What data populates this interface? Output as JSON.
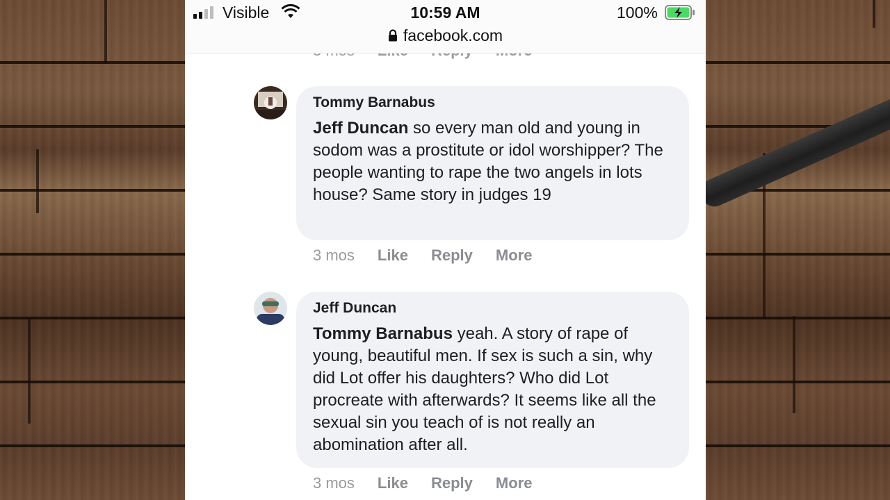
{
  "status_bar": {
    "carrier": "Visible",
    "time": "10:59 AM",
    "battery": "100%",
    "url": "facebook.com"
  },
  "previous_comment": {
    "timestamp": "3 mos",
    "like": "Like",
    "reply": "Reply",
    "more": "More"
  },
  "comments": [
    {
      "author": "Tommy Barnabus",
      "mention": "Jeff Duncan",
      "text": " so every man old and young in sodom was a prostitute or idol worshipper? The people wanting to rape the two angels in lots house? Same story in judges 19",
      "timestamp": "3 mos",
      "like": "Like",
      "reply": "Reply",
      "more": "More"
    },
    {
      "author": "Jeff Duncan",
      "mention": "Tommy Barnabus",
      "text": " yeah. A story of rape of young, beautiful men. If sex is such a sin, why did Lot offer his daughters? Who did Lot procreate with afterwards? It seems like all the sexual sin you teach of is not really an abomination after all.",
      "timestamp": "3 mos",
      "like": "Like",
      "reply": "Reply",
      "more": "More"
    }
  ],
  "colors": {
    "bubble": "#f0f2f5",
    "battery_fill": "#4cd964",
    "meta_text": "#8a8d91"
  }
}
